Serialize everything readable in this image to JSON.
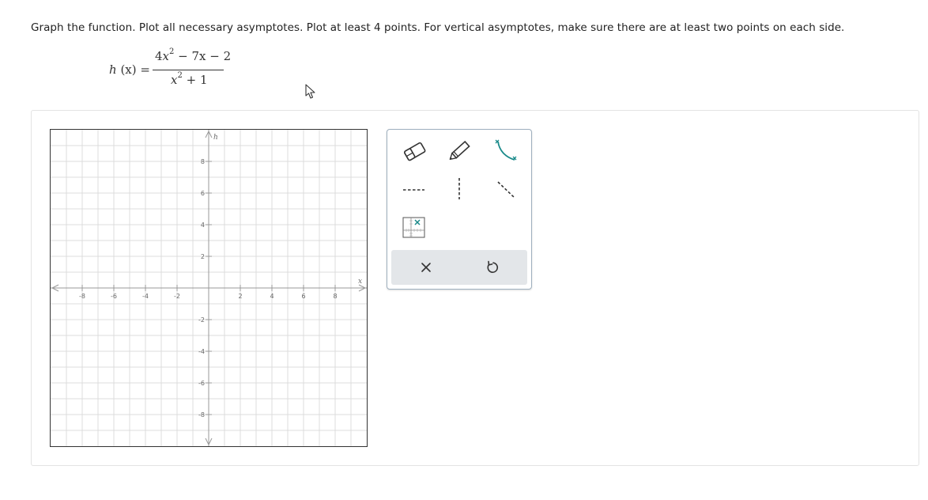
{
  "instructions": "Graph the function. Plot all necessary asymptotes. Plot at least 4 points. For vertical asymptotes, make sure there are at least two points on each side.",
  "formula": {
    "lhs_fn": "h",
    "lhs_arg": "(x) =",
    "numerator": {
      "coef": "4",
      "var": "x",
      "exp": "2",
      "rest": " − 7x − 2"
    },
    "denominator": {
      "var": "x",
      "exp": "2",
      "rest": " + 1"
    }
  },
  "graph": {
    "x_axis_label": "x",
    "y_axis_label": "h",
    "x_range": [
      -10,
      10
    ],
    "y_range": [
      -10,
      10
    ],
    "grid_step": 1,
    "tick_label_step": 2,
    "x_tick_labels": [
      "-8",
      "-6",
      "-4",
      "-2",
      "2",
      "4",
      "6",
      "8"
    ],
    "y_tick_labels": [
      "8",
      "6",
      "4",
      "2",
      "-2",
      "-4",
      "-6",
      "-8"
    ],
    "grid": true
  },
  "toolbar": {
    "tools": [
      {
        "name": "eraser-tool",
        "icon": "eraser-icon"
      },
      {
        "name": "pencil-tool",
        "icon": "pencil-icon"
      },
      {
        "name": "curve-tool",
        "icon": "curve-icon"
      },
      {
        "name": "horizontal-asymptote-tool",
        "icon": "horizontal-dashed-line-icon"
      },
      {
        "name": "vertical-asymptote-tool",
        "icon": "vertical-dashed-line-icon"
      },
      {
        "name": "oblique-asymptote-tool",
        "icon": "diagonal-dashed-line-icon"
      },
      {
        "name": "point-tool",
        "icon": "grid-point-icon"
      }
    ],
    "footer": [
      {
        "name": "clear-button",
        "icon": "close-icon"
      },
      {
        "name": "undo-button",
        "icon": "undo-icon"
      }
    ]
  },
  "colors": {
    "grid": "#dcdcdc",
    "axis": "#999999",
    "graph_border": "#333333",
    "teal": "#1a8a8a",
    "toolbar_border": "#9fb0bf",
    "footer_bg": "#e3e6e9"
  }
}
